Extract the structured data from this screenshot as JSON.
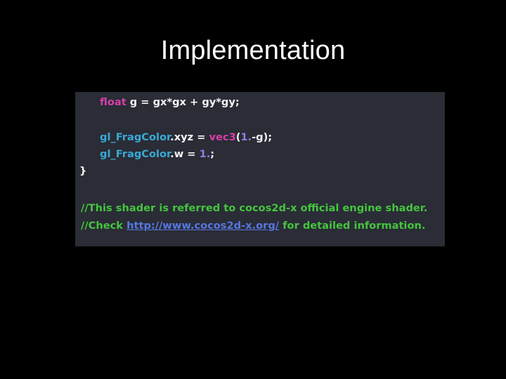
{
  "slide": {
    "title": "Implementation"
  },
  "code": {
    "line1": {
      "kw": "float",
      "rest": " g = gx*gx + gy*gy;"
    },
    "line2": {
      "ident": "gl_FragColor",
      "mid": ".xyz = ",
      "kw": "vec3",
      "open": "(",
      "num": "1.",
      "tail": "-g);"
    },
    "line3": {
      "ident": "gl_FragColor",
      "mid": ".w = ",
      "num": "1.",
      "tail": ";"
    },
    "line4": "}",
    "comment1": "//This shader is referred to cocos2d-x official engine shader.",
    "comment2": {
      "prefix": "//Check ",
      "link": "http://www.cocos2d-x.org/",
      "suffix": " for detailed information."
    }
  },
  "colors": {
    "background": "#000000",
    "code_background": "#2a2c36",
    "keyword": "#d63fa8",
    "identifier": "#39a9d6",
    "number": "#8f7fe3",
    "comment": "#45c43e",
    "link": "#5577e0",
    "text": "#f4f4f4"
  }
}
